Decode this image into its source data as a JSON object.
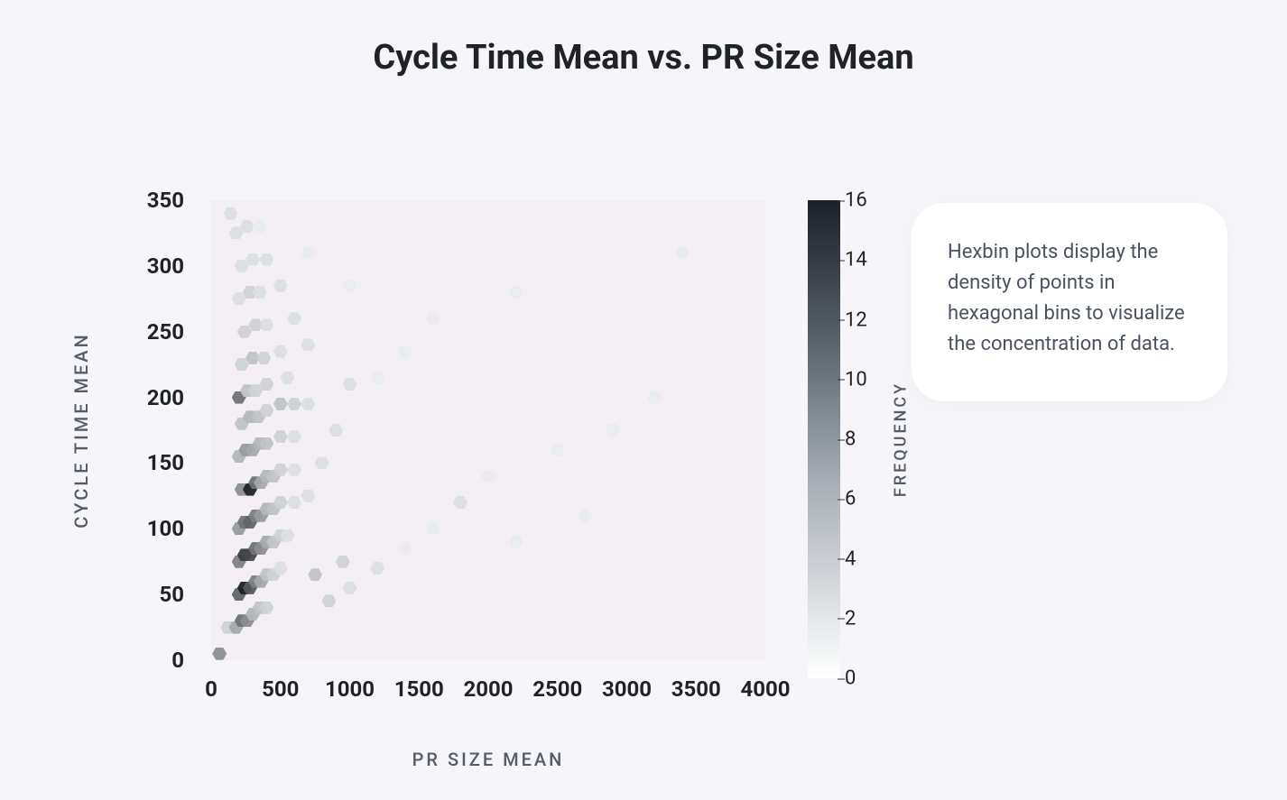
{
  "title": "Cycle Time Mean vs. PR Size Mean",
  "xlabel": "PR SIZE MEAN",
  "ylabel": "CYCLE TIME MEAN",
  "colorbar_label": "FREQUENCY",
  "info_text": "Hexbin plots display the density of points in hexagonal bins to visualize the concentration of data.",
  "chart_data": {
    "type": "heatmap",
    "subtype": "hexbin",
    "title": "Cycle Time Mean vs. PR Size Mean",
    "xlabel": "PR SIZE MEAN",
    "ylabel": "CYCLE TIME MEAN",
    "colorbar_label": "FREQUENCY",
    "xlim": [
      0,
      4000
    ],
    "ylim": [
      0,
      350
    ],
    "clim": [
      0,
      16
    ],
    "x_ticks": [
      0,
      500,
      1000,
      1500,
      2000,
      2500,
      3000,
      3500,
      4000
    ],
    "y_ticks": [
      0,
      50,
      100,
      150,
      200,
      250,
      300,
      350
    ],
    "colorbar_ticks": [
      0,
      2,
      4,
      6,
      8,
      10,
      12,
      14,
      16
    ],
    "colormap": "greys",
    "bins": [
      {
        "x": 60,
        "y": 5,
        "count": 8
      },
      {
        "x": 120,
        "y": 25,
        "count": 3
      },
      {
        "x": 180,
        "y": 25,
        "count": 6
      },
      {
        "x": 220,
        "y": 30,
        "count": 10
      },
      {
        "x": 260,
        "y": 30,
        "count": 8
      },
      {
        "x": 300,
        "y": 35,
        "count": 5
      },
      {
        "x": 350,
        "y": 40,
        "count": 4
      },
      {
        "x": 400,
        "y": 40,
        "count": 3
      },
      {
        "x": 200,
        "y": 50,
        "count": 11
      },
      {
        "x": 240,
        "y": 55,
        "count": 16
      },
      {
        "x": 280,
        "y": 55,
        "count": 12
      },
      {
        "x": 320,
        "y": 60,
        "count": 9
      },
      {
        "x": 360,
        "y": 60,
        "count": 6
      },
      {
        "x": 400,
        "y": 65,
        "count": 4
      },
      {
        "x": 450,
        "y": 65,
        "count": 3
      },
      {
        "x": 500,
        "y": 70,
        "count": 2
      },
      {
        "x": 200,
        "y": 75,
        "count": 9
      },
      {
        "x": 240,
        "y": 80,
        "count": 14
      },
      {
        "x": 280,
        "y": 80,
        "count": 13
      },
      {
        "x": 320,
        "y": 85,
        "count": 10
      },
      {
        "x": 360,
        "y": 85,
        "count": 8
      },
      {
        "x": 400,
        "y": 90,
        "count": 6
      },
      {
        "x": 450,
        "y": 90,
        "count": 4
      },
      {
        "x": 500,
        "y": 95,
        "count": 3
      },
      {
        "x": 550,
        "y": 95,
        "count": 2
      },
      {
        "x": 200,
        "y": 100,
        "count": 7
      },
      {
        "x": 240,
        "y": 105,
        "count": 10
      },
      {
        "x": 280,
        "y": 105,
        "count": 11
      },
      {
        "x": 320,
        "y": 110,
        "count": 9
      },
      {
        "x": 360,
        "y": 110,
        "count": 7
      },
      {
        "x": 400,
        "y": 115,
        "count": 5
      },
      {
        "x": 450,
        "y": 115,
        "count": 4
      },
      {
        "x": 500,
        "y": 120,
        "count": 3
      },
      {
        "x": 600,
        "y": 120,
        "count": 2
      },
      {
        "x": 700,
        "y": 125,
        "count": 2
      },
      {
        "x": 220,
        "y": 130,
        "count": 8
      },
      {
        "x": 280,
        "y": 130,
        "count": 16
      },
      {
        "x": 320,
        "y": 135,
        "count": 10
      },
      {
        "x": 360,
        "y": 135,
        "count": 6
      },
      {
        "x": 400,
        "y": 140,
        "count": 5
      },
      {
        "x": 450,
        "y": 140,
        "count": 4
      },
      {
        "x": 500,
        "y": 145,
        "count": 3
      },
      {
        "x": 600,
        "y": 145,
        "count": 2
      },
      {
        "x": 800,
        "y": 150,
        "count": 2
      },
      {
        "x": 200,
        "y": 155,
        "count": 5
      },
      {
        "x": 250,
        "y": 160,
        "count": 7
      },
      {
        "x": 300,
        "y": 160,
        "count": 6
      },
      {
        "x": 350,
        "y": 165,
        "count": 5
      },
      {
        "x": 400,
        "y": 165,
        "count": 4
      },
      {
        "x": 500,
        "y": 170,
        "count": 3
      },
      {
        "x": 600,
        "y": 170,
        "count": 2
      },
      {
        "x": 900,
        "y": 175,
        "count": 2
      },
      {
        "x": 220,
        "y": 180,
        "count": 4
      },
      {
        "x": 280,
        "y": 185,
        "count": 5
      },
      {
        "x": 340,
        "y": 185,
        "count": 4
      },
      {
        "x": 400,
        "y": 190,
        "count": 3
      },
      {
        "x": 500,
        "y": 195,
        "count": 4
      },
      {
        "x": 600,
        "y": 195,
        "count": 3
      },
      {
        "x": 700,
        "y": 195,
        "count": 2
      },
      {
        "x": 200,
        "y": 200,
        "count": 10
      },
      {
        "x": 260,
        "y": 205,
        "count": 4
      },
      {
        "x": 320,
        "y": 205,
        "count": 3
      },
      {
        "x": 400,
        "y": 210,
        "count": 3
      },
      {
        "x": 550,
        "y": 215,
        "count": 2
      },
      {
        "x": 1000,
        "y": 210,
        "count": 2
      },
      {
        "x": 1200,
        "y": 215,
        "count": 1
      },
      {
        "x": 220,
        "y": 225,
        "count": 3
      },
      {
        "x": 300,
        "y": 230,
        "count": 4
      },
      {
        "x": 380,
        "y": 230,
        "count": 3
      },
      {
        "x": 500,
        "y": 235,
        "count": 2
      },
      {
        "x": 700,
        "y": 240,
        "count": 2
      },
      {
        "x": 1400,
        "y": 235,
        "count": 1
      },
      {
        "x": 240,
        "y": 250,
        "count": 3
      },
      {
        "x": 320,
        "y": 255,
        "count": 3
      },
      {
        "x": 400,
        "y": 255,
        "count": 2
      },
      {
        "x": 600,
        "y": 260,
        "count": 2
      },
      {
        "x": 1600,
        "y": 260,
        "count": 1
      },
      {
        "x": 200,
        "y": 275,
        "count": 2
      },
      {
        "x": 280,
        "y": 280,
        "count": 3
      },
      {
        "x": 350,
        "y": 280,
        "count": 2
      },
      {
        "x": 500,
        "y": 285,
        "count": 2
      },
      {
        "x": 1000,
        "y": 285,
        "count": 1
      },
      {
        "x": 2200,
        "y": 280,
        "count": 1
      },
      {
        "x": 220,
        "y": 300,
        "count": 2
      },
      {
        "x": 300,
        "y": 305,
        "count": 2
      },
      {
        "x": 400,
        "y": 305,
        "count": 2
      },
      {
        "x": 700,
        "y": 310,
        "count": 1
      },
      {
        "x": 3400,
        "y": 310,
        "count": 1
      },
      {
        "x": 180,
        "y": 325,
        "count": 2
      },
      {
        "x": 260,
        "y": 330,
        "count": 2
      },
      {
        "x": 350,
        "y": 330,
        "count": 1
      },
      {
        "x": 140,
        "y": 340,
        "count": 2
      },
      {
        "x": 1000,
        "y": 55,
        "count": 2
      },
      {
        "x": 1200,
        "y": 70,
        "count": 2
      },
      {
        "x": 1400,
        "y": 85,
        "count": 1
      },
      {
        "x": 1600,
        "y": 100,
        "count": 1
      },
      {
        "x": 1800,
        "y": 120,
        "count": 2
      },
      {
        "x": 2000,
        "y": 140,
        "count": 1
      },
      {
        "x": 2200,
        "y": 90,
        "count": 1
      },
      {
        "x": 2500,
        "y": 160,
        "count": 1
      },
      {
        "x": 2700,
        "y": 110,
        "count": 1
      },
      {
        "x": 2900,
        "y": 175,
        "count": 1
      },
      {
        "x": 3200,
        "y": 200,
        "count": 1
      },
      {
        "x": 850,
        "y": 45,
        "count": 3
      },
      {
        "x": 950,
        "y": 75,
        "count": 3
      },
      {
        "x": 750,
        "y": 65,
        "count": 4
      }
    ]
  }
}
